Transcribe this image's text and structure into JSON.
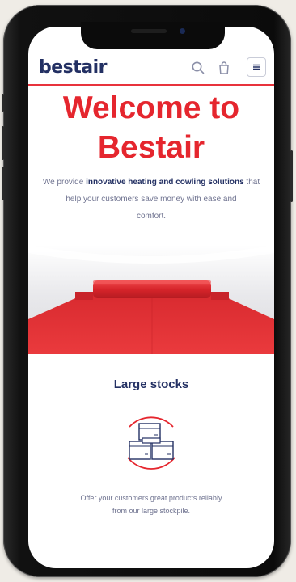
{
  "header": {
    "logo_text": "bestair",
    "icons": [
      "search-icon",
      "bag-icon",
      "menu-icon"
    ]
  },
  "hero": {
    "title_line1": "Welcome to",
    "title_line2": "Bestair",
    "text_prefix": "We provide ",
    "text_bold": "innovative heating and cowling solutions",
    "text_after_bold": " that",
    "text_line3": "help your customers save money with ease and",
    "text_line4": "comfort."
  },
  "feature": {
    "title": "Large stocks",
    "icon": "boxes-icon",
    "text_line1": "Offer your customers great products reliably",
    "text_line2": "from our large stockpile."
  },
  "colors": {
    "brand_red": "#e5262e",
    "brand_navy": "#233063",
    "body_text": "#6f7390"
  }
}
